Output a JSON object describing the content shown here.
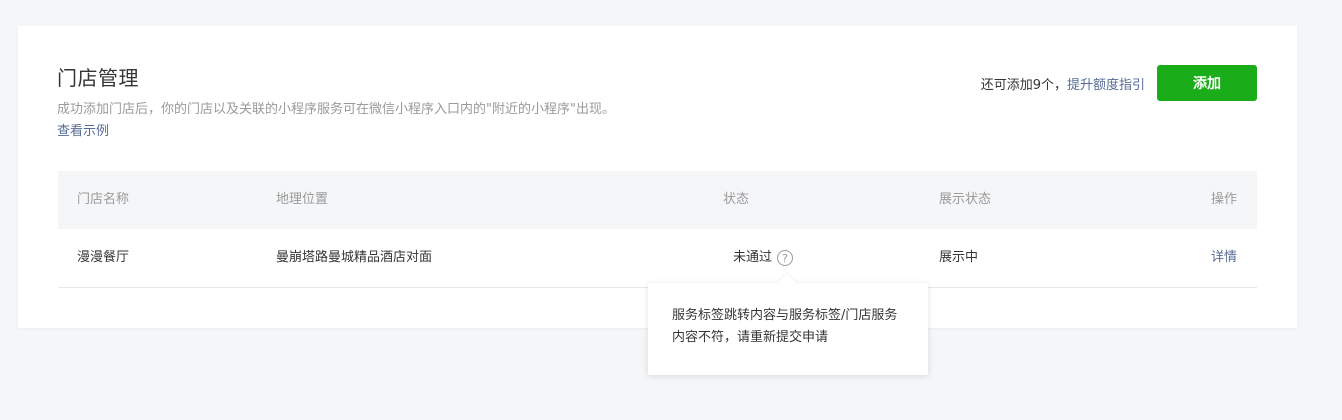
{
  "header": {
    "title": "门店管理",
    "description": "成功添加门店后，你的门店以及关联的小程序服务可在微信小程序入口内的\"附近的小程序\"出现。",
    "example_link": "查看示例",
    "quota_prefix": "还可添加9个，",
    "quota_guide": "提升额度指引",
    "add_button": "添加"
  },
  "table": {
    "columns": [
      "门店名称",
      "地理位置",
      "状态",
      "展示状态",
      "操作"
    ],
    "rows": [
      {
        "name": "漫漫餐厅",
        "location": "曼崩塔路曼城精品酒店对面",
        "status": "未通过",
        "display_status": "展示中",
        "action": "详情"
      }
    ]
  },
  "tooltip": {
    "text": "服务标签跳转内容与服务标签/门店服务内容不符，请重新提交申请"
  },
  "icons": {
    "status_help": "question-circle-icon"
  },
  "colors": {
    "accent_green": "#1aad19",
    "link_blue": "#576b95",
    "muted_text": "#9a9a9a"
  }
}
